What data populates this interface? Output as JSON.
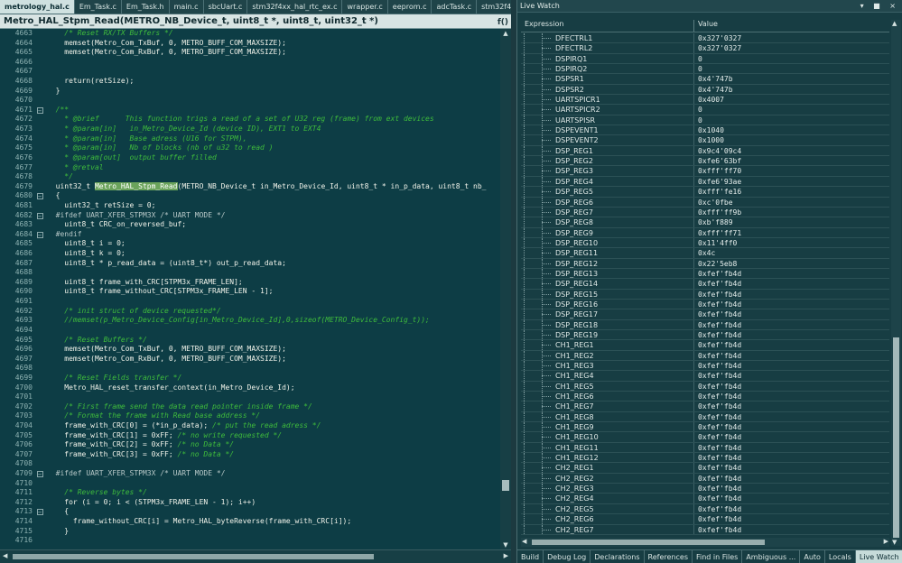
{
  "editor": {
    "tabs": [
      {
        "label": "metrology_hal.c",
        "active": true
      },
      {
        "label": "Em_Task.c",
        "active": false
      },
      {
        "label": "Em_Task.h",
        "active": false
      },
      {
        "label": "main.c",
        "active": false
      },
      {
        "label": "sbcUart.c",
        "active": false
      },
      {
        "label": "stm32f4xx_hal_rtc_ex.c",
        "active": false
      },
      {
        "label": "wrapper.c",
        "active": false
      },
      {
        "label": "eeprom.c",
        "active": false
      },
      {
        "label": "adcTask.c",
        "active": false
      },
      {
        "label": "stm32f427xx.h",
        "active": false
      }
    ],
    "close_glyph": "×",
    "function_bar": "Metro_HAL_Stpm_Read(METRO_NB_Device_t, uint8_t *, uint8_t, uint32_t *)",
    "function_bar_btn": "f()",
    "lines": [
      {
        "n": "4663",
        "fold": "",
        "t": "    /* Reset RX/TX Buffers */",
        "k": "cm"
      },
      {
        "n": "4664",
        "fold": "",
        "t": "    memset(Metro_Com_TxBuf, 0, METRO_BUFF_COM_MAXSIZE);",
        "k": ""
      },
      {
        "n": "4665",
        "fold": "",
        "t": "    memset(Metro_Com_RxBuf, 0, METRO_BUFF_COM_MAXSIZE);",
        "k": ""
      },
      {
        "n": "4666",
        "fold": "",
        "t": "",
        "k": ""
      },
      {
        "n": "4667",
        "fold": "",
        "t": "",
        "k": ""
      },
      {
        "n": "4668",
        "fold": "",
        "t": "    return(retSize);",
        "k": ""
      },
      {
        "n": "4669",
        "fold": "",
        "t": "  }",
        "k": ""
      },
      {
        "n": "4670",
        "fold": "",
        "t": "",
        "k": ""
      },
      {
        "n": "4671",
        "fold": "box",
        "t": "  /**",
        "k": "cm"
      },
      {
        "n": "4672",
        "fold": "",
        "t": "    * @brief      This function trigs a read of a set of U32 reg (frame) from ext devices",
        "k": "cm"
      },
      {
        "n": "4673",
        "fold": "",
        "t": "    * @param[in]   in_Metro_Device_Id (device ID), EXT1 to EXT4",
        "k": "cm"
      },
      {
        "n": "4674",
        "fold": "",
        "t": "    * @param[in]   Base adress (U16 for STPM),",
        "k": "cm"
      },
      {
        "n": "4675",
        "fold": "",
        "t": "    * @param[in]   Nb of blocks (nb of u32 to read )",
        "k": "cm"
      },
      {
        "n": "4676",
        "fold": "",
        "t": "    * @param[out]  output buffer filled",
        "k": "cm"
      },
      {
        "n": "4677",
        "fold": "",
        "t": "    * @retval",
        "k": "cm"
      },
      {
        "n": "4678",
        "fold": "",
        "t": "    */",
        "k": "cm"
      },
      {
        "n": "4679",
        "fold": "",
        "t": "  uint32_t ",
        "hl": "Metro_HAL_Stpm_Read",
        "rest": "(METRO_NB_Device_t in_Metro_Device_Id, uint8_t * in_p_data, uint8_t nb_",
        "k": "fn"
      },
      {
        "n": "4680",
        "fold": "box",
        "t": "  {",
        "k": ""
      },
      {
        "n": "4681",
        "fold": "",
        "t": "    uint32_t retSize = 0;",
        "k": ""
      },
      {
        "n": "4682",
        "fold": "box",
        "t": "  #ifdef UART_XFER_STPM3X /* UART MODE */",
        "k": "pp"
      },
      {
        "n": "4683",
        "fold": "",
        "t": "    uint8_t CRC_on_reversed_buf;",
        "k": ""
      },
      {
        "n": "4684",
        "fold": "box",
        "t": "  #endif",
        "k": "pp"
      },
      {
        "n": "4685",
        "fold": "",
        "t": "    uint8_t i = 0;",
        "k": ""
      },
      {
        "n": "4686",
        "fold": "",
        "t": "    uint8_t k = 0;",
        "k": ""
      },
      {
        "n": "4687",
        "fold": "",
        "t": "    uint8_t * p_read_data = (uint8_t*) out_p_read_data;",
        "k": ""
      },
      {
        "n": "4688",
        "fold": "",
        "t": "",
        "k": ""
      },
      {
        "n": "4689",
        "fold": "",
        "t": "    uint8_t frame_with_CRC[STPM3x_FRAME_LEN];",
        "k": ""
      },
      {
        "n": "4690",
        "fold": "",
        "t": "    uint8_t frame_without_CRC[STPM3x_FRAME_LEN - 1];",
        "k": ""
      },
      {
        "n": "4691",
        "fold": "",
        "t": "",
        "k": ""
      },
      {
        "n": "4692",
        "fold": "",
        "t": "    /* init struct of device requested*/",
        "k": "cm"
      },
      {
        "n": "4693",
        "fold": "",
        "t": "    //memset(p_Metro_Device_Config[in_Metro_Device_Id],0,sizeof(METRO_Device_Config_t));",
        "k": "cm"
      },
      {
        "n": "4694",
        "fold": "",
        "t": "",
        "k": ""
      },
      {
        "n": "4695",
        "fold": "",
        "t": "    /* Reset Buffers */",
        "k": "cm"
      },
      {
        "n": "4696",
        "fold": "",
        "t": "    memset(Metro_Com_TxBuf, 0, METRO_BUFF_COM_MAXSIZE);",
        "k": ""
      },
      {
        "n": "4697",
        "fold": "",
        "t": "    memset(Metro_Com_RxBuf, 0, METRO_BUFF_COM_MAXSIZE);",
        "k": ""
      },
      {
        "n": "4698",
        "fold": "",
        "t": "",
        "k": ""
      },
      {
        "n": "4699",
        "fold": "",
        "t": "    /* Reset Fields transfer */",
        "k": "cm"
      },
      {
        "n": "4700",
        "fold": "",
        "t": "    Metro_HAL_reset_transfer_context(in_Metro_Device_Id);",
        "k": ""
      },
      {
        "n": "4701",
        "fold": "",
        "t": "",
        "k": ""
      },
      {
        "n": "4702",
        "fold": "",
        "t": "    /* First frame send the data read pointer inside frame */",
        "k": "cm"
      },
      {
        "n": "4703",
        "fold": "",
        "t": "    /* Format the frame with Read base address */",
        "k": "cm"
      },
      {
        "n": "4704",
        "fold": "",
        "t": "    frame_with_CRC[0] = (*in_p_data); /* put the read adress */",
        "k": "mix"
      },
      {
        "n": "4705",
        "fold": "",
        "t": "    frame_with_CRC[1] = 0xFF; /* no write requested */",
        "k": "mix"
      },
      {
        "n": "4706",
        "fold": "",
        "t": "    frame_with_CRC[2] = 0xFF; /* no Data */",
        "k": "mix"
      },
      {
        "n": "4707",
        "fold": "",
        "t": "    frame_with_CRC[3] = 0xFF; /* no Data */",
        "k": "mix"
      },
      {
        "n": "4708",
        "fold": "",
        "t": "",
        "k": ""
      },
      {
        "n": "4709",
        "fold": "box",
        "t": "  #ifdef UART_XFER_STPM3X /* UART MODE */",
        "k": "pp"
      },
      {
        "n": "4710",
        "fold": "",
        "t": "",
        "k": ""
      },
      {
        "n": "4711",
        "fold": "",
        "t": "    /* Reverse bytes */",
        "k": "cm"
      },
      {
        "n": "4712",
        "fold": "",
        "t": "    for (i = 0; i < (STPM3x_FRAME_LEN - 1); i++)",
        "k": ""
      },
      {
        "n": "4713",
        "fold": "box",
        "t": "    {",
        "k": ""
      },
      {
        "n": "4714",
        "fold": "",
        "t": "      frame_without_CRC[i] = Metro_HAL_byteReverse(frame_with_CRC[i]);",
        "k": ""
      },
      {
        "n": "4715",
        "fold": "",
        "t": "    }",
        "k": ""
      },
      {
        "n": "4716",
        "fold": "",
        "t": "",
        "k": ""
      }
    ]
  },
  "watch": {
    "title": "Live Watch",
    "controls": "▾ ■ ×",
    "col_expression": "Expression",
    "col_value": "Value",
    "rows": [
      {
        "name": "DFECTRL1",
        "value": "0x327'0327"
      },
      {
        "name": "DFECTRL2",
        "value": "0x327'0327"
      },
      {
        "name": "DSPIRQ1",
        "value": "0"
      },
      {
        "name": "DSPIRQ2",
        "value": "0"
      },
      {
        "name": "DSPSR1",
        "value": "0x4'747b"
      },
      {
        "name": "DSPSR2",
        "value": "0x4'747b"
      },
      {
        "name": "UARTSPICR1",
        "value": "0x4007"
      },
      {
        "name": "UARTSPICR2",
        "value": "0"
      },
      {
        "name": "UARTSPISR",
        "value": "0"
      },
      {
        "name": "DSPEVENT1",
        "value": "0x1040"
      },
      {
        "name": "DSPEVENT2",
        "value": "0x1000"
      },
      {
        "name": "DSP_REG1",
        "value": "0x9c4'09c4"
      },
      {
        "name": "DSP_REG2",
        "value": "0xfe6'63bf"
      },
      {
        "name": "DSP_REG3",
        "value": "0xfff'ff70"
      },
      {
        "name": "DSP_REG4",
        "value": "0xfe6'93ae"
      },
      {
        "name": "DSP_REG5",
        "value": "0xfff'fe16"
      },
      {
        "name": "DSP_REG6",
        "value": "0xc'0fbe"
      },
      {
        "name": "DSP_REG7",
        "value": "0xfff'ff9b"
      },
      {
        "name": "DSP_REG8",
        "value": "0xb'f889"
      },
      {
        "name": "DSP_REG9",
        "value": "0xfff'ff71"
      },
      {
        "name": "DSP_REG10",
        "value": "0x11'4ff0"
      },
      {
        "name": "DSP_REG11",
        "value": "0x4c"
      },
      {
        "name": "DSP_REG12",
        "value": "0x22'5eb8"
      },
      {
        "name": "DSP_REG13",
        "value": "0xfef'fb4d"
      },
      {
        "name": "DSP_REG14",
        "value": "0xfef'fb4d"
      },
      {
        "name": "DSP_REG15",
        "value": "0xfef'fb4d"
      },
      {
        "name": "DSP_REG16",
        "value": "0xfef'fb4d"
      },
      {
        "name": "DSP_REG17",
        "value": "0xfef'fb4d"
      },
      {
        "name": "DSP_REG18",
        "value": "0xfef'fb4d"
      },
      {
        "name": "DSP_REG19",
        "value": "0xfef'fb4d"
      },
      {
        "name": "CH1_REG1",
        "value": "0xfef'fb4d"
      },
      {
        "name": "CH1_REG2",
        "value": "0xfef'fb4d"
      },
      {
        "name": "CH1_REG3",
        "value": "0xfef'fb4d"
      },
      {
        "name": "CH1_REG4",
        "value": "0xfef'fb4d"
      },
      {
        "name": "CH1_REG5",
        "value": "0xfef'fb4d"
      },
      {
        "name": "CH1_REG6",
        "value": "0xfef'fb4d"
      },
      {
        "name": "CH1_REG7",
        "value": "0xfef'fb4d"
      },
      {
        "name": "CH1_REG8",
        "value": "0xfef'fb4d"
      },
      {
        "name": "CH1_REG9",
        "value": "0xfef'fb4d"
      },
      {
        "name": "CH1_REG10",
        "value": "0xfef'fb4d"
      },
      {
        "name": "CH1_REG11",
        "value": "0xfef'fb4d"
      },
      {
        "name": "CH1_REG12",
        "value": "0xfef'fb4d"
      },
      {
        "name": "CH2_REG1",
        "value": "0xfef'fb4d"
      },
      {
        "name": "CH2_REG2",
        "value": "0xfef'fb4d"
      },
      {
        "name": "CH2_REG3",
        "value": "0xfef'fb4d"
      },
      {
        "name": "CH2_REG4",
        "value": "0xfef'fb4d"
      },
      {
        "name": "CH2_REG5",
        "value": "0xfef'fb4d"
      },
      {
        "name": "CH2_REG6",
        "value": "0xfef'fb4d"
      },
      {
        "name": "CH2_REG7",
        "value": "0xfef'fb4d"
      }
    ]
  },
  "bottom_tabs": [
    {
      "label": "Build",
      "active": false
    },
    {
      "label": "Debug Log",
      "active": false
    },
    {
      "label": "Declarations",
      "active": false
    },
    {
      "label": "References",
      "active": false
    },
    {
      "label": "Find in Files",
      "active": false
    },
    {
      "label": "Ambiguous ...",
      "active": false
    },
    {
      "label": "Auto",
      "active": false
    },
    {
      "label": "Locals",
      "active": false
    },
    {
      "label": "Live Watch",
      "active": true
    }
  ]
}
